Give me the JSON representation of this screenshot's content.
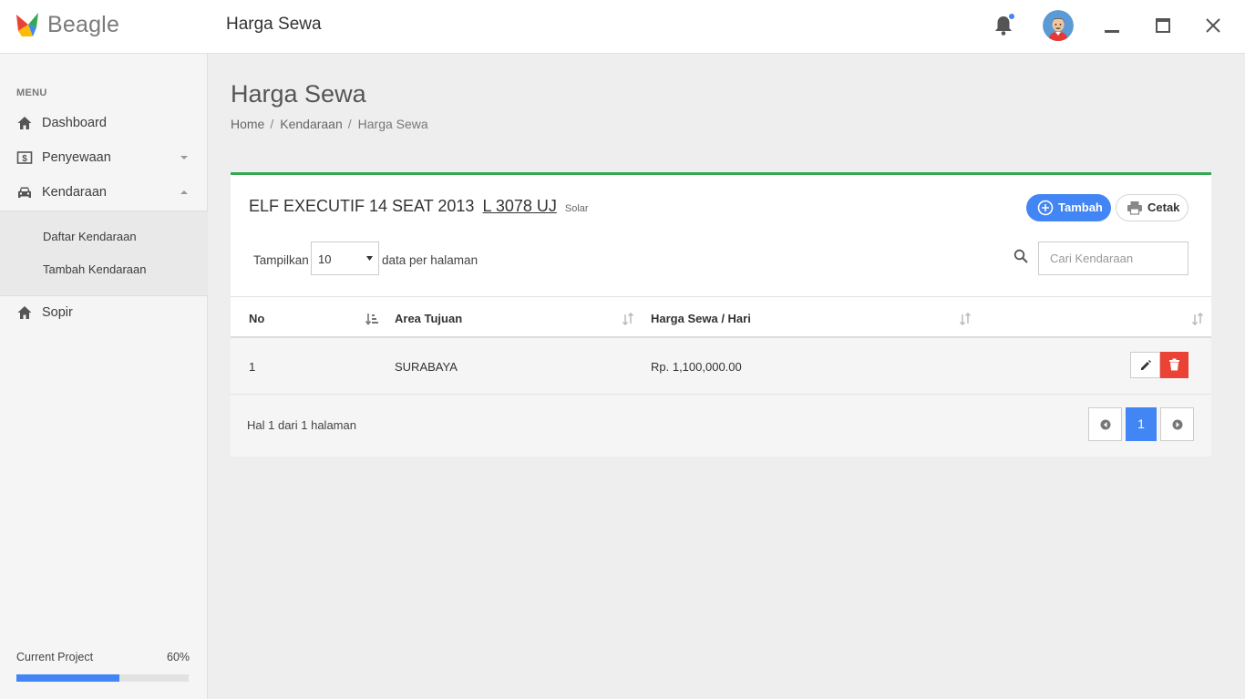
{
  "app": {
    "name": "Beagle",
    "page_heading": "Harga Sewa"
  },
  "sidebar": {
    "caption": "MENU",
    "items": [
      {
        "label": "Dashboard",
        "icon": "home-icon"
      },
      {
        "label": "Penyewaan",
        "icon": "dollar-icon"
      },
      {
        "label": "Kendaraan",
        "icon": "car-icon"
      },
      {
        "label": "Sopir",
        "icon": "home-icon"
      }
    ],
    "subitems": [
      {
        "label": "Daftar Kendaraan"
      },
      {
        "label": "Tambah Kendaraan"
      }
    ],
    "project": {
      "label": "Current Project",
      "value_text": "60%",
      "progress": 0.6
    }
  },
  "main": {
    "title": "Harga Sewa",
    "breadcrumb": [
      "Home",
      "Kendaraan",
      "Harga Sewa"
    ]
  },
  "panel": {
    "vehicle": "ELF EXECUTIF 14 SEAT 2013",
    "plate": "L 3078 UJ",
    "fuel": "Solar",
    "add_label": "Tambah",
    "print_label": "Cetak",
    "length_prefix": "Tampilkan",
    "length_value": "10",
    "length_suffix": "data per halaman",
    "search_placeholder": "Cari Kendaraan",
    "columns": [
      "No",
      "Area Tujuan",
      "Harga Sewa / Hari"
    ],
    "rows": [
      {
        "no": "1",
        "area": "SURABAYA",
        "price": "Rp. 1,100,000.00"
      }
    ],
    "page_info": "Hal 1 dari 1 halaman",
    "current_page": "1"
  },
  "colors": {
    "primary": "#4285f4",
    "success": "#34a853",
    "danger": "#ea4335"
  }
}
